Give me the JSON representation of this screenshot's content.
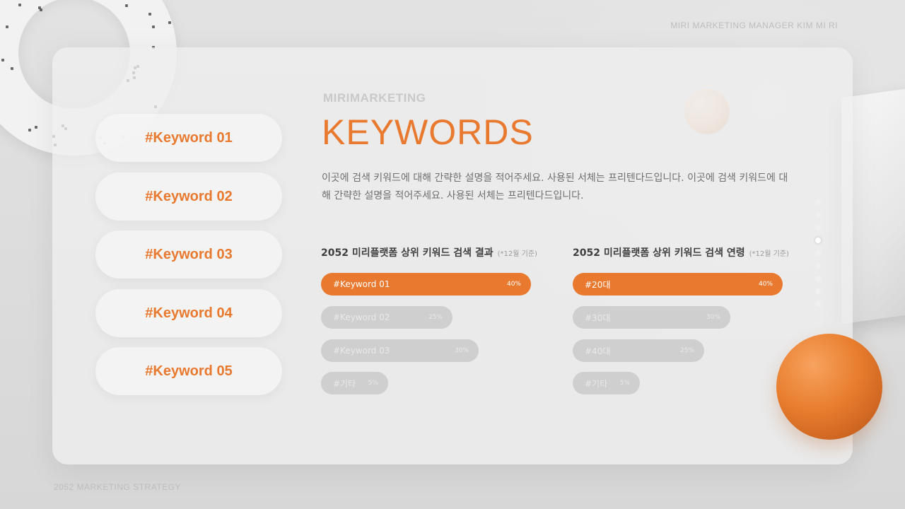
{
  "header": {
    "credit": "MIRI MARKETING MANAGER KIM MI RI"
  },
  "footer": {
    "label": "2052 MARKETING STRATEGY"
  },
  "sidebar": {
    "keywords": [
      "#Keyword 01",
      "#Keyword 02",
      "#Keyword 03",
      "#Keyword 04",
      "#Keyword 05"
    ]
  },
  "main": {
    "brand": "MIRIMARKETING",
    "title": "KEYWORDS",
    "description": "이곳에 검색 키워드에 대해 간략한 설명을 적어주세요. 사용된 서체는 프리텐다드입니다. 이곳에 검색 키워드에 대해 간략한 설명을 적어주세요. 사용된 서체는 프리텐다드입니다."
  },
  "charts": [
    {
      "title": "2052 미리플랫폼 상위 키워드 검색 결과",
      "note": "(*12월 기준)",
      "items": [
        {
          "label": "#Keyword 01",
          "value": 40,
          "display": "40%",
          "active": true
        },
        {
          "label": "#Keyword 02",
          "value": 25,
          "display": "25%",
          "active": false
        },
        {
          "label": "#Keyword 03",
          "value": 30,
          "display": "30%",
          "active": false
        },
        {
          "label": "#기타",
          "value": 5,
          "display": "5%",
          "active": false
        }
      ]
    },
    {
      "title": "2052 미리플랫폼 상위 키워드 검색 연령",
      "note": "(*12월 기준)",
      "items": [
        {
          "label": "#20대",
          "value": 40,
          "display": "40%",
          "active": true
        },
        {
          "label": "#30대",
          "value": 30,
          "display": "30%",
          "active": false
        },
        {
          "label": "#40대",
          "value": 25,
          "display": "25%",
          "active": false
        },
        {
          "label": "#기타",
          "value": 5,
          "display": "5%",
          "active": false
        }
      ]
    }
  ],
  "pagination": {
    "count": 9,
    "active_index": 3
  },
  "colors": {
    "accent": "#e8792f",
    "bar_inactive": "#cfcfcf"
  }
}
